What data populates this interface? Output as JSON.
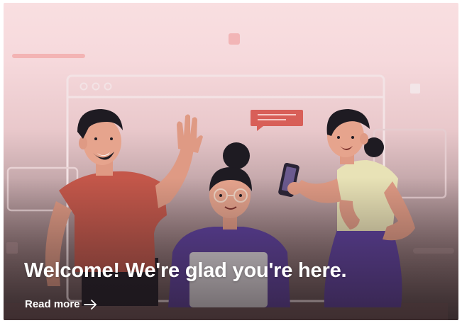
{
  "hero": {
    "headline": "Welcome! We're glad you're here.",
    "cta_label": "Read more",
    "cta_icon": "arrow-right-icon"
  },
  "colors": {
    "background_top": "#f9dfe1",
    "shirt_red": "#c4574a",
    "shirt_purple": "#5b3fa0",
    "shirt_cream": "#e8e2b6",
    "skin": "#e09a84",
    "hair": "#1e1b22",
    "chat_bubble": "#d85f58"
  }
}
